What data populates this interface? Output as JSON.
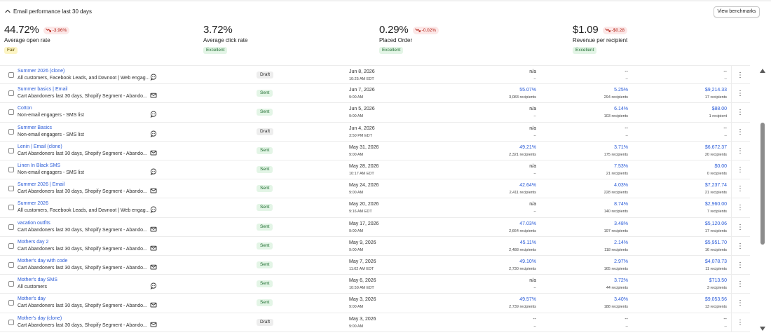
{
  "header": {
    "title": "Email performance last 30 days",
    "benchmarks_label": "View benchmarks"
  },
  "metrics": [
    {
      "value": "44.72%",
      "delta": "-3.96%",
      "label": "Average open rate",
      "badge": "Fair",
      "badge_kind": "fair"
    },
    {
      "value": "3.72%",
      "delta": "",
      "label": "Average click rate",
      "badge": "Excellent",
      "badge_kind": "good"
    },
    {
      "value": "0.29%",
      "delta": "-0.02%",
      "label": "Placed Order",
      "badge": "Excellent",
      "badge_kind": "good"
    },
    {
      "value": "$1.09",
      "delta": "-$0.28",
      "label": "Revenue per recipient",
      "badge": "Excellent",
      "badge_kind": "good"
    }
  ],
  "colors": {
    "link": "#2a5bd7",
    "sent_bg": "#e3f5e6",
    "draft_bg": "#ededed",
    "negative": "#b42318"
  },
  "campaigns": [
    {
      "name": "Summer 2026 (clone)",
      "audience": "All customers, Facebook Leads, and Davnoot | Web engag...",
      "channel": "sms-icon",
      "status": "Draft",
      "date": "Jun 8, 2026",
      "time": "10:25 AM EDT",
      "open": "n/a",
      "open_sub": "--",
      "click": "--",
      "click_sub": "--",
      "revenue": "--",
      "revenue_sub": "--"
    },
    {
      "name": "Summer basics | Email",
      "audience": "Cart Abandoners last 30 days, Shopify Segment - Abando...",
      "channel": "email-icon",
      "status": "Sent",
      "date": "Jun 7, 2026",
      "time": "9:00 AM",
      "open": "55.07%",
      "open_sub": "3,083 recipients",
      "click": "5.25%",
      "click_sub": "294 recipients",
      "revenue": "$9,214.33",
      "revenue_sub": "17 recipients"
    },
    {
      "name": "Cotton",
      "audience": "Non-email engagers - SMS list",
      "channel": "sms-icon",
      "status": "Sent",
      "date": "Jun 5, 2026",
      "time": "9:00 AM",
      "open": "n/a",
      "open_sub": "--",
      "click": "6.14%",
      "click_sub": "103 recipients",
      "revenue": "$88.00",
      "revenue_sub": "1 recipient"
    },
    {
      "name": "Summer Basics",
      "audience": "Non-email engagers - SMS list",
      "channel": "sms-icon",
      "status": "Draft",
      "date": "Jun 4, 2026",
      "time": "3:50 PM EDT",
      "open": "n/a",
      "open_sub": "--",
      "click": "--",
      "click_sub": "--",
      "revenue": "--",
      "revenue_sub": "--"
    },
    {
      "name": "Lenin | Email (clone)",
      "audience": "Cart Abandoners last 30 days, Shopify Segment - Abando...",
      "channel": "email-icon",
      "status": "Sent",
      "date": "May 31, 2026",
      "time": "9:00 AM",
      "open": "49.21%",
      "open_sub": "2,321 recipients",
      "click": "3.71%",
      "click_sub": "175 recipients",
      "revenue": "$6,672.37",
      "revenue_sub": "20 recipients"
    },
    {
      "name": "Linen In Black SMS",
      "audience": "Non-email engagers - SMS list",
      "channel": "sms-icon",
      "status": "Sent",
      "date": "May 28, 2026",
      "time": "10:17 AM EDT",
      "open": "n/a",
      "open_sub": "--",
      "click": "7.53%",
      "click_sub": "21 recipients",
      "revenue": "$0.00",
      "revenue_sub": "0 recipients"
    },
    {
      "name": "Summer 2026 | Email",
      "audience": "Cart Abandoners last 30 days, Shopify Segment - Abando...",
      "channel": "email-icon",
      "status": "Sent",
      "date": "May 24, 2026",
      "time": "9:00 AM",
      "open": "42.64%",
      "open_sub": "2,411 recipients",
      "click": "4.03%",
      "click_sub": "228 recipients",
      "revenue": "$7,237.74",
      "revenue_sub": "21 recipients"
    },
    {
      "name": "Summer 2026",
      "audience": "All customers, Facebook Leads, and Davnoot | Web engag...",
      "channel": "sms-icon",
      "status": "Sent",
      "date": "May 20, 2026",
      "time": "9:16 AM EDT",
      "open": "n/a",
      "open_sub": "--",
      "click": "8.74%",
      "click_sub": "140 recipients",
      "revenue": "$2,960.00",
      "revenue_sub": "7 recipients"
    },
    {
      "name": "vacation outfits",
      "audience": "Cart Abandoners last 30 days, Shopify Segment - Abando...",
      "channel": "email-icon",
      "status": "Sent",
      "date": "May 17, 2026",
      "time": "9:00 AM",
      "open": "47.03%",
      "open_sub": "2,664 recipients",
      "click": "3.48%",
      "click_sub": "197 recipients",
      "revenue": "$5,120.06",
      "revenue_sub": "17 recipients"
    },
    {
      "name": "Mothers day 2",
      "audience": "Cart Abandoners last 30 days, Shopify Segment - Abando...",
      "channel": "email-icon",
      "status": "Sent",
      "date": "May 9, 2026",
      "time": "9:00 AM",
      "open": "45.11%",
      "open_sub": "2,488 recipients",
      "click": "2.14%",
      "click_sub": "118 recipients",
      "revenue": "$5,951.70",
      "revenue_sub": "16 recipients"
    },
    {
      "name": "Mother's day with code",
      "audience": "Cart Abandoners last 30 days, Shopify Segment - Abando...",
      "channel": "email-icon",
      "status": "Sent",
      "date": "May 7, 2026",
      "time": "11:02 AM EDT",
      "open": "49.10%",
      "open_sub": "2,730 recipients",
      "click": "2.97%",
      "click_sub": "165 recipients",
      "revenue": "$4,078.73",
      "revenue_sub": "11 recipients"
    },
    {
      "name": "Mother's day SMS",
      "audience": "All customers",
      "channel": "sms-icon",
      "status": "Sent",
      "date": "May 6, 2026",
      "time": "10:50 AM EDT",
      "open": "n/a",
      "open_sub": "--",
      "click": "3.72%",
      "click_sub": "44 recipients",
      "revenue": "$713.50",
      "revenue_sub": "3 recipients"
    },
    {
      "name": "Mother's day",
      "audience": "Cart Abandoners last 30 days, Shopify Segment - Abando...",
      "channel": "email-icon",
      "status": "Sent",
      "date": "May 3, 2026",
      "time": "9:00 AM",
      "open": "49.57%",
      "open_sub": "2,739 recipients",
      "click": "3.40%",
      "click_sub": "188 recipients",
      "revenue": "$9,053.56",
      "revenue_sub": "13 recipients"
    },
    {
      "name": "Mother's day (clone)",
      "audience": "Cart Abandoners last 30 days, Shopify Segment - Abando...",
      "channel": "email-icon",
      "status": "Draft",
      "date": "May 3, 2026",
      "time": "9:00 AM",
      "open": "--",
      "open_sub": "--",
      "click": "--",
      "click_sub": "--",
      "revenue": "--",
      "revenue_sub": "--"
    }
  ]
}
